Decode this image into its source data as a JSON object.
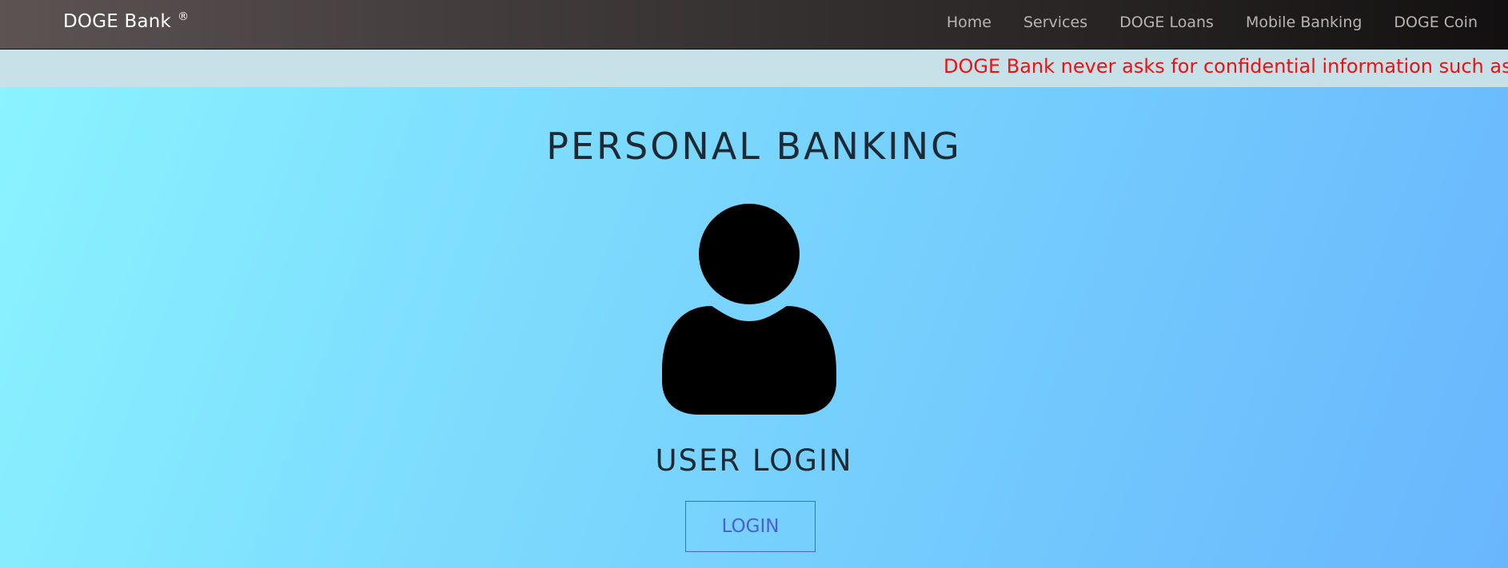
{
  "navbar": {
    "brand": "DOGE Bank",
    "brand_mark": "®",
    "links": [
      "Home",
      "Services",
      "DOGE Loans",
      "Mobile Banking",
      "DOGE Coin"
    ]
  },
  "ticker": {
    "text": "DOGE Bank never asks for confidential information such as",
    "color": "#f20f0f"
  },
  "main": {
    "title": "PERSONAL BANKING",
    "avatar_icon": "user-icon",
    "subtitle": "USER LOGIN",
    "login_label": "LOGIN"
  }
}
